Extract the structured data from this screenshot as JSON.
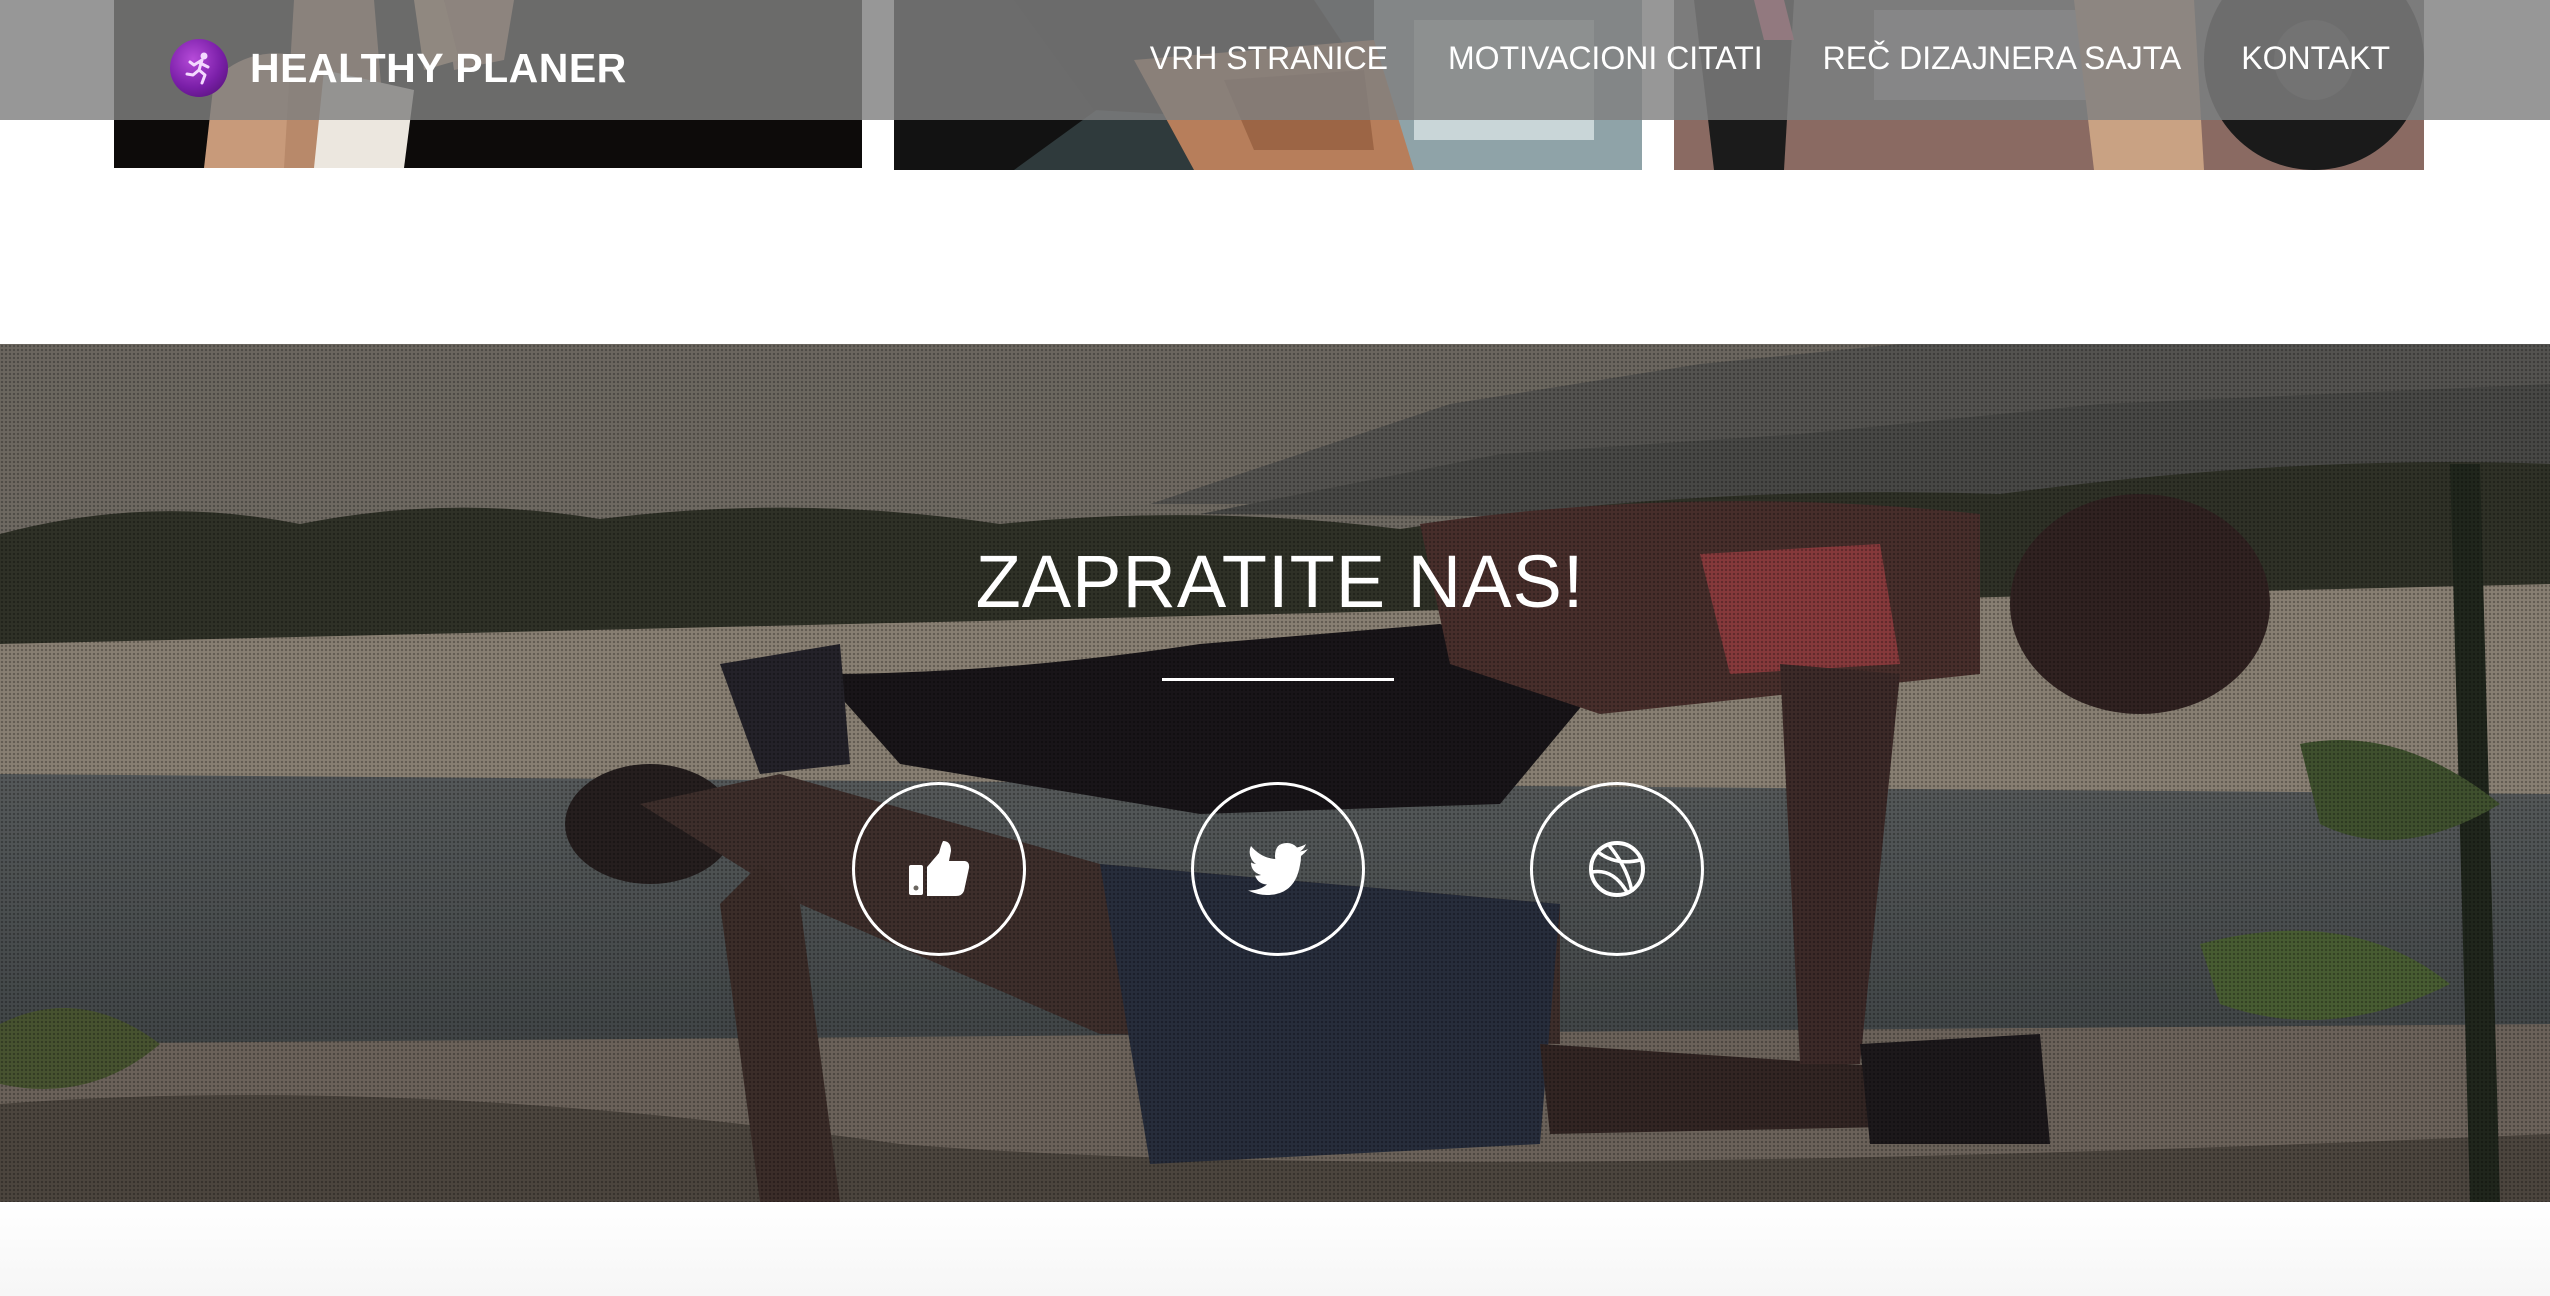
{
  "header": {
    "brand_name": "HEALTHY PLANER",
    "logo_icon": "runner-icon",
    "nav": [
      {
        "label": "VRH STRANICE"
      },
      {
        "label": "MOTIVACIONI CITATI"
      },
      {
        "label": "REČ DIZAJNERA SAJTA"
      },
      {
        "label": "KONTAKT"
      }
    ]
  },
  "follow": {
    "title": "ZAPRATITE NAS!",
    "social": [
      {
        "icon": "thumbs-up-icon"
      },
      {
        "icon": "twitter-bird-icon"
      },
      {
        "icon": "dribbble-icon"
      }
    ]
  },
  "colors": {
    "header_bg": "#808080",
    "brand_logo": "#7a1fa8",
    "text": "#ffffff"
  }
}
